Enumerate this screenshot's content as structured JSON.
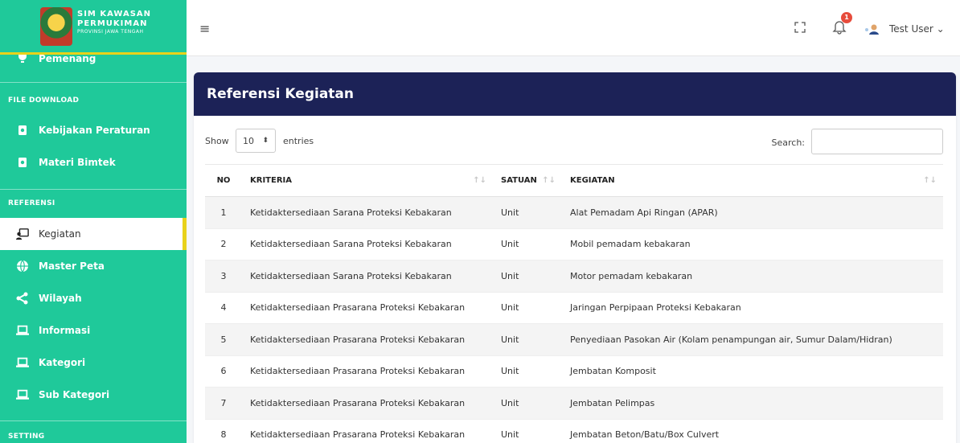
{
  "brand": {
    "title_line1": "SIM KAWASAN",
    "title_line2": "PERMUKIMAN",
    "subtitle": "PROVINSI JAWA TENGAH"
  },
  "sidebar": {
    "partial_item": "Pemenang",
    "sections": {
      "file_download": "FILE DOWNLOAD",
      "referensi": "REFERENSI",
      "setting": "SETTING"
    },
    "file_download_items": [
      {
        "label": "Kebijakan Peraturan",
        "icon": "document-icon"
      },
      {
        "label": "Materi Bimtek",
        "icon": "document-icon"
      }
    ],
    "referensi_items": [
      {
        "label": "Kegiatan",
        "icon": "presentation-icon",
        "active": true
      },
      {
        "label": "Master Peta",
        "icon": "globe-icon"
      },
      {
        "label": "Wilayah",
        "icon": "share-icon"
      },
      {
        "label": "Informasi",
        "icon": "laptop-icon"
      },
      {
        "label": "Kategori",
        "icon": "laptop-icon"
      },
      {
        "label": "Sub Kategori",
        "icon": "laptop-icon"
      }
    ]
  },
  "topbar": {
    "notification_count": "1",
    "user_name": "Test User ⌄"
  },
  "page": {
    "title": "Referensi Kegiatan",
    "show_label": "Show",
    "entries_value": "10",
    "entries_label": "entries",
    "search_label": "Search:",
    "search_value": ""
  },
  "table": {
    "headers": [
      "NO",
      "KRITERIA",
      "SATUAN",
      "KEGIATAN"
    ],
    "rows": [
      {
        "no": "1",
        "kriteria": "Ketidaktersediaan Sarana Proteksi Kebakaran",
        "satuan": "Unit",
        "kegiatan": "Alat Pemadam Api Ringan (APAR)"
      },
      {
        "no": "2",
        "kriteria": "Ketidaktersediaan Sarana Proteksi Kebakaran",
        "satuan": "Unit",
        "kegiatan": "Mobil pemadam kebakaran"
      },
      {
        "no": "3",
        "kriteria": "Ketidaktersediaan Sarana Proteksi Kebakaran",
        "satuan": "Unit",
        "kegiatan": "Motor pemadam kebakaran"
      },
      {
        "no": "4",
        "kriteria": "Ketidaktersediaan Prasarana Proteksi Kebakaran",
        "satuan": "Unit",
        "kegiatan": "Jaringan Perpipaan Proteksi Kebakaran"
      },
      {
        "no": "5",
        "kriteria": "Ketidaktersediaan Prasarana Proteksi Kebakaran",
        "satuan": "Unit",
        "kegiatan": "Penyediaan Pasokan Air (Kolam penampungan air, Sumur Dalam/Hidran)"
      },
      {
        "no": "6",
        "kriteria": "Ketidaktersediaan Prasarana Proteksi Kebakaran",
        "satuan": "Unit",
        "kegiatan": "Jembatan Komposit"
      },
      {
        "no": "7",
        "kriteria": "Ketidaktersediaan Prasarana Proteksi Kebakaran",
        "satuan": "Unit",
        "kegiatan": "Jembatan Pelimpas"
      },
      {
        "no": "8",
        "kriteria": "Ketidaktersediaan Prasarana Proteksi Kebakaran",
        "satuan": "Unit",
        "kegiatan": "Jembatan Beton/Batu/Box Culvert"
      }
    ]
  },
  "colors": {
    "sidebar_bg": "#1fc99a",
    "accent_yellow": "#e8d21a",
    "header_navy": "#1c2257"
  }
}
